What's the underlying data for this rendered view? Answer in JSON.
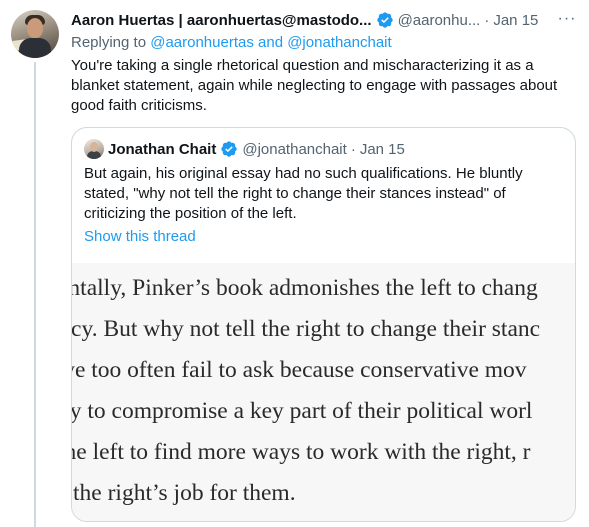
{
  "tweet": {
    "author_name": "Aaron Huertas | aaronhuertas@mastodo...",
    "handle": "@aaronhu...",
    "separator": "·",
    "time": "Jan 15",
    "more_glyph": "···",
    "replying_prefix": "Replying to",
    "replying_mentions": "@aaronhuertas and @jonathanchait",
    "text": "You're taking a single rhetorical question and mischaracterizing it as a blanket statement, again while neglecting to engage with passages about good faith criticisms."
  },
  "quote": {
    "author_name": "Jonathan Chait",
    "handle": "@jonathanchait",
    "separator": "·",
    "time": "Jan 15",
    "text": "But again, his original essay had no such qualifications. He bluntly stated, \"why not tell the right to change their stances instead\" of criticizing the position of the left.",
    "show_thread": "Show this thread",
    "excerpt_lines": [
      "entally, Pinker’s book admonishes the left to chang",
      "licy. But why not tell the right to change their stanc",
      "we too often fail to ask because conservative mov",
      "hy to compromise a key part of their political worl",
      "the left to find more ways to work with the right, r",
      "s the right’s job for them."
    ]
  },
  "colors": {
    "text": "#0f1419",
    "secondary": "#536471",
    "accent": "#1d9bf0",
    "border": "#cfd9de",
    "excerpt_bg": "#f7f7f7"
  },
  "icons": {
    "verified": "verified-badge-icon",
    "more": "more-options-icon"
  }
}
